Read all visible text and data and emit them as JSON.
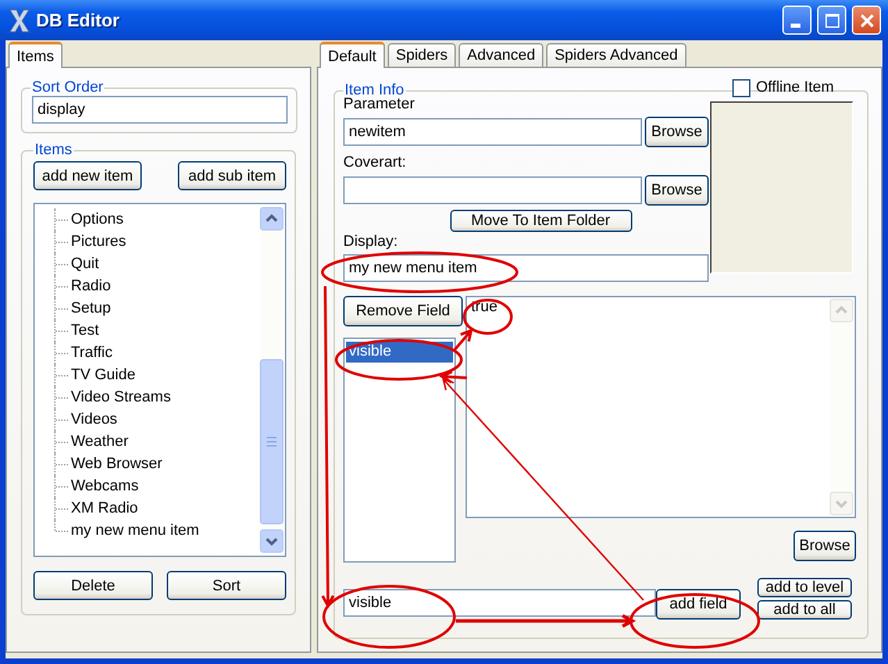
{
  "window": {
    "title": "DB Editor"
  },
  "left_tabs": [
    {
      "label": "Items",
      "selected": true
    }
  ],
  "sort_order": {
    "legend": "Sort Order",
    "value": "display"
  },
  "items_group": {
    "legend": "Items",
    "buttons": [
      "add new item",
      "add sub item"
    ],
    "tree": [
      {
        "label": "Options"
      },
      {
        "label": "Pictures"
      },
      {
        "label": "Quit"
      },
      {
        "label": "Radio"
      },
      {
        "label": "Setup"
      },
      {
        "label": "Test"
      },
      {
        "label": "Traffic"
      },
      {
        "label": "TV Guide"
      },
      {
        "label": "Video Streams"
      },
      {
        "label": "Videos"
      },
      {
        "label": "Weather"
      },
      {
        "label": "Web Browser"
      },
      {
        "label": "Webcams"
      },
      {
        "label": "XM Radio"
      },
      {
        "label": "my new menu item"
      }
    ],
    "bottom_buttons": [
      "Delete",
      "Sort"
    ]
  },
  "tabs": [
    {
      "label": "Default",
      "selected": true
    },
    {
      "label": "Spiders",
      "selected": false
    },
    {
      "label": "Advanced",
      "selected": false
    },
    {
      "label": "Spiders Advanced",
      "selected": false
    }
  ],
  "item_info": {
    "legend": "Item Info",
    "parameter": {
      "label": "Parameter",
      "value": "newitem",
      "button": "Browse"
    },
    "coverart": {
      "label": "Coverart:",
      "button": "Browse"
    },
    "offline_item": {
      "label": "Offline Item",
      "checked": false
    },
    "move_button": "Move To Item Folder",
    "display": {
      "label": "Display:",
      "value": "my new menu item"
    }
  },
  "fields": {
    "remove_button": "Remove Field",
    "list": [
      {
        "label": "visible",
        "selected": true
      }
    ],
    "value": "true",
    "browse_button": "Browse",
    "new_field": "visible",
    "add_field_button": "add field",
    "add_to_level_button": "add to level",
    "add_to_all_button": "add to all"
  }
}
